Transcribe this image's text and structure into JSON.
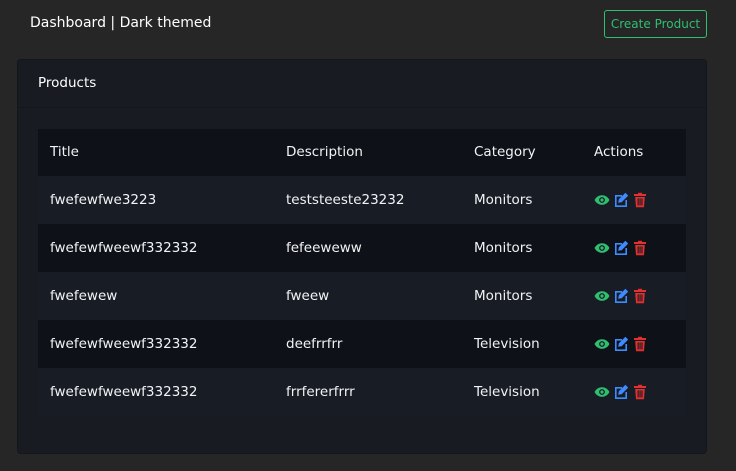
{
  "header": {
    "title": "Dashboard | Dark themed",
    "create_label": "Create Product"
  },
  "card": {
    "title": "Products"
  },
  "table": {
    "columns": [
      "Title",
      "Description",
      "Category",
      "Actions"
    ],
    "rows": [
      {
        "title": "fwefewfwe3223",
        "description": "teststeeste23232",
        "category": "Monitors"
      },
      {
        "title": "fwefewfweewf332332",
        "description": "fefeeweww",
        "category": "Monitors"
      },
      {
        "title": "fwefewew",
        "description": "fweew",
        "category": "Monitors"
      },
      {
        "title": "fwefewfweewf332332",
        "description": "deefrrfrr",
        "category": "Television"
      },
      {
        "title": "fwefewfweewf332332",
        "description": "frrfererfrrr",
        "category": "Television"
      }
    ]
  },
  "icons": {
    "view": "eye-icon",
    "edit": "edit-icon",
    "delete": "trash-icon"
  },
  "colors": {
    "accent_green": "#2fbf71",
    "edit_blue": "#3d8bfd",
    "delete_red": "#e03131"
  }
}
